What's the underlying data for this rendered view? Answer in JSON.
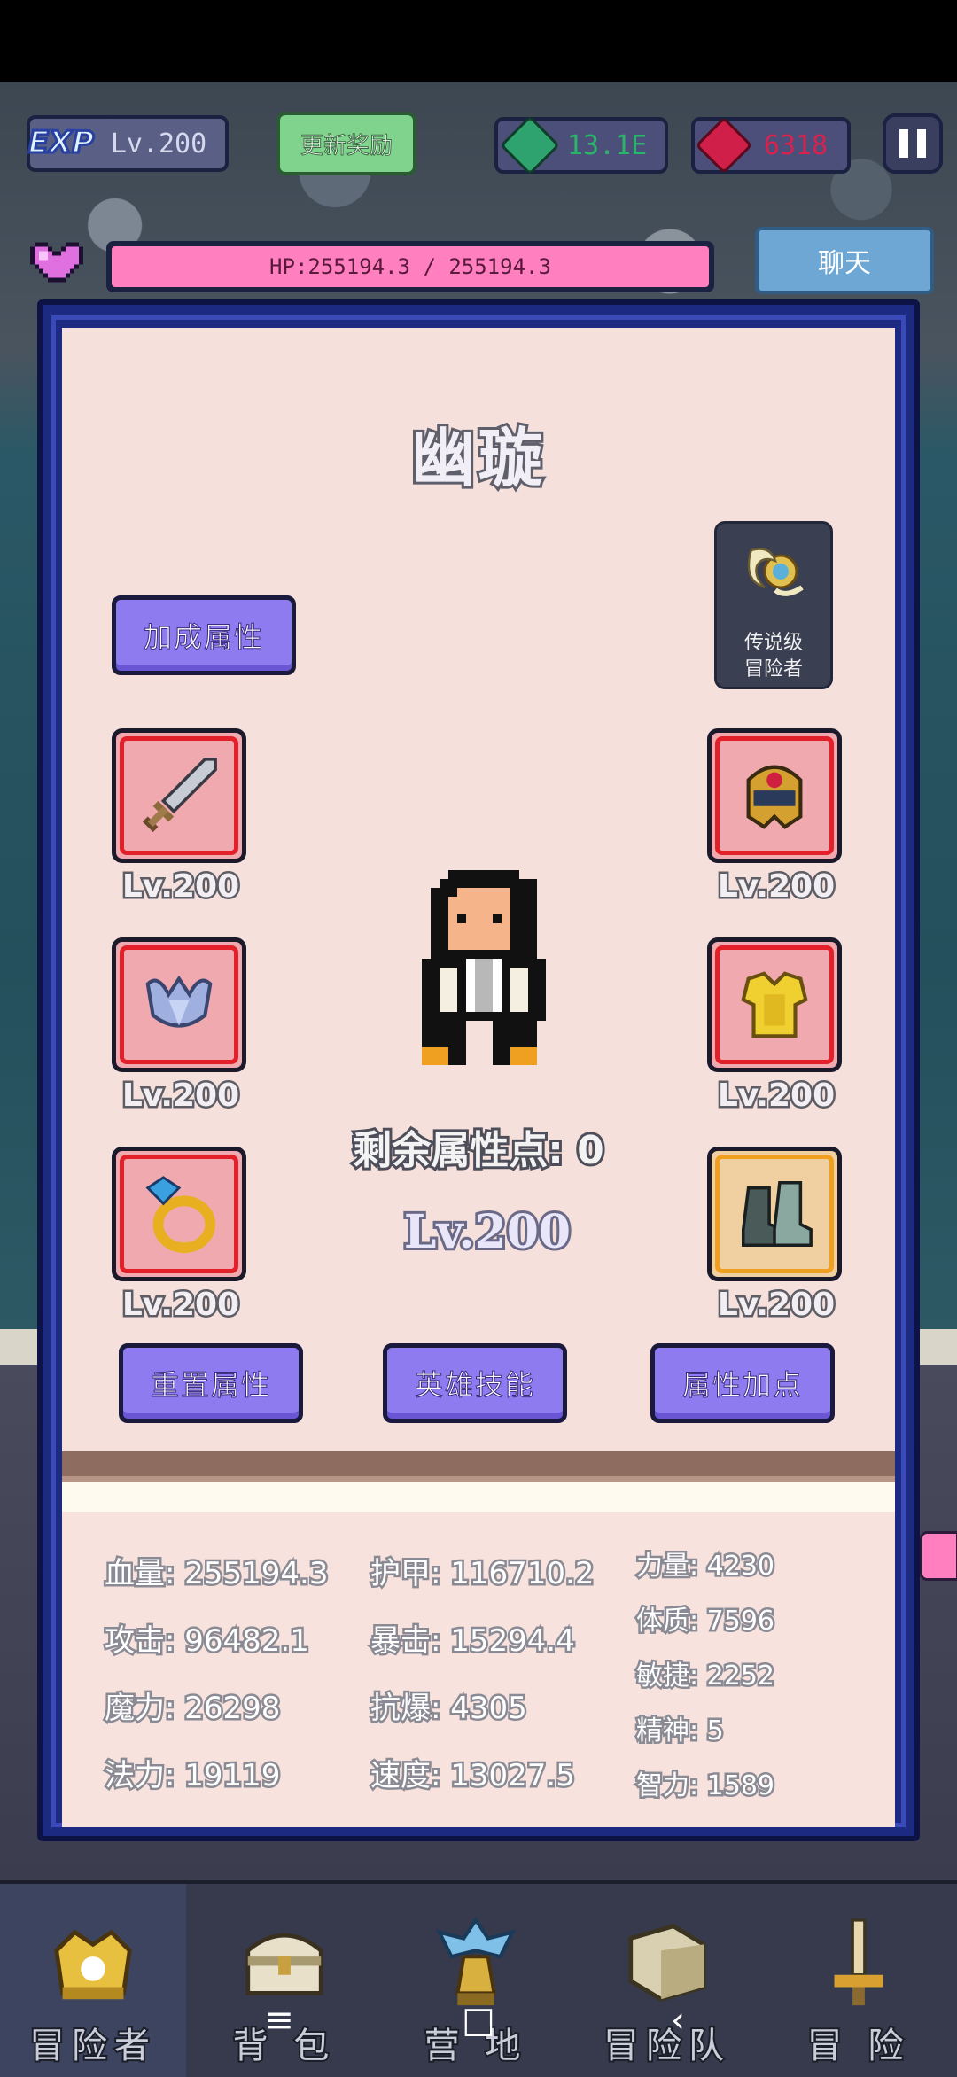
{
  "hud": {
    "exp_badge": "EXP",
    "level": "Lv.200",
    "reward_button": "更新奖励",
    "gems": "13.1E",
    "rubies": "6318",
    "hp": "HP:255194.3 / 255194.3",
    "chat_button": "聊天"
  },
  "hero": {
    "name": "幽璇",
    "bonus_button": "加成属性",
    "legend_badge_line1": "传说级",
    "legend_badge_line2": "冒险者",
    "remaining_points": "剩余属性点: 0",
    "level": "Lv.200"
  },
  "equipment": {
    "weapon_level": "Lv.200",
    "helmet_level": "Lv.200",
    "shoulder_level": "Lv.200",
    "armor_level": "Lv.200",
    "ring_level": "Lv.200",
    "boots_level": "Lv.200"
  },
  "actions": {
    "reset": "重置属性",
    "skills": "英雄技能",
    "allocate": "属性加点"
  },
  "stats": {
    "hp": "血量: 255194.3",
    "attack": "攻击: 96482.1",
    "magic": "魔力: 26298",
    "spell": "法力: 19119",
    "armor": "护甲: 116710.2",
    "crit": "暴击: 15294.4",
    "anti_crit": "抗爆: 4305",
    "speed": "速度: 13027.5",
    "strength": "力量: 4230",
    "constitution": "体质: 7596",
    "agility": "敏捷: 2252",
    "spirit": "精神: 5",
    "intellect": "智力: 1589"
  },
  "nav": {
    "adventurer": "冒险者",
    "bag": "背 包",
    "camp": "营 地",
    "party": "冒险队",
    "adventure": "冒 险"
  },
  "colors": {
    "panel_bg": "#f5e0dc",
    "frame_blue": "#1c2a82",
    "button_purple": "#8f7bf0",
    "hp_pink": "#ff7fbf",
    "slot_red": "#e2202a",
    "slot_gold": "#f0a020"
  }
}
